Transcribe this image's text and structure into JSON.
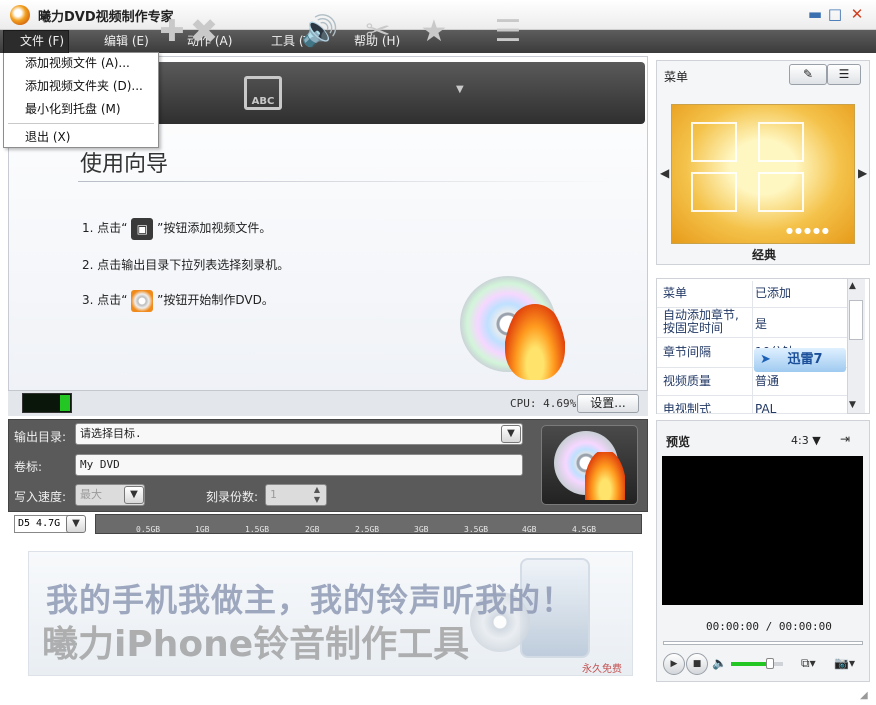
{
  "window": {
    "title": "曦力DVD视频制作专家",
    "min_glyph": "▬",
    "max_glyph": "□",
    "close_glyph": "✕"
  },
  "menubar": {
    "items": [
      {
        "label": "文件 (F)"
      },
      {
        "label": "编辑 (E)"
      },
      {
        "label": "动作 (A)"
      },
      {
        "label": "工具 (T)"
      },
      {
        "label": "帮助 (H)"
      }
    ]
  },
  "file_menu": {
    "items": [
      {
        "label": "添加视频文件 (A)..."
      },
      {
        "label": "添加视频文件夹 (D)..."
      },
      {
        "label": "最小化到托盘 (M)"
      },
      {
        "label": "退出 (X)"
      }
    ]
  },
  "toolbar": {
    "icons": [
      "add-video-icon",
      "delete-icon",
      "subtitle-icon",
      "audio-icon",
      "cut-icon",
      "effect-icon",
      "chapter-icon"
    ],
    "subtitle_label": "ABC"
  },
  "wizard": {
    "title": "使用向导",
    "step1_prefix": "1. 点击“",
    "step1_suffix": "”按钮添加视频文件。",
    "step2": "2. 点击输出目录下拉列表选择刻录机。",
    "step3_prefix": "3. 点击“",
    "step3_suffix": "”按钮开始制作DVD。"
  },
  "status": {
    "cpu_text": "CPU: 4.69%",
    "cpu_level": 0.2,
    "settings_label": "设置..."
  },
  "output": {
    "dir_label": "输出目录:",
    "dir_value": "请选择目标.",
    "volume_label": "卷标:",
    "volume_value": "My DVD",
    "speed_label": "写入速度:",
    "speed_value": "最大",
    "copies_label": "刻录份数:",
    "copies_value": "1"
  },
  "capacity": {
    "disc_type": "D5 4.7G",
    "ticks": [
      "0.5GB",
      "1GB",
      "1.5GB",
      "2GB",
      "2.5GB",
      "3GB",
      "3.5GB",
      "4GB",
      "4.5GB"
    ]
  },
  "ad": {
    "line1": "我的手机我做主，我的铃声听我的！",
    "line2": "曦力iPhone铃音制作工具",
    "free": "永久免费"
  },
  "menu_panel": {
    "title": "菜单",
    "theme_name": "经典"
  },
  "props": {
    "rows": [
      {
        "key": "菜单",
        "value": "已添加"
      },
      {
        "key": "自动添加章节,",
        "key2": "按固定时间",
        "value": "是"
      },
      {
        "key": "章节间隔",
        "value": "10分钟"
      },
      {
        "key": "视频质量",
        "value": "普通"
      },
      {
        "key": "电视制式",
        "value": "PAL"
      }
    ],
    "xunlei_text": "迅雷7"
  },
  "preview": {
    "title": "预览",
    "aspect": "4:3",
    "time": "00:00:00 / 00:00:00",
    "volume_level": 0.75
  },
  "colors": {
    "menubar_bg": "#4a4a4a",
    "toolbar_bg": "#3c3c3c",
    "accent_green": "#23c623"
  }
}
